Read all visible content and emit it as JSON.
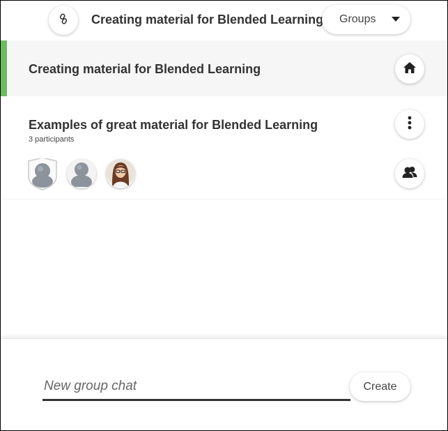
{
  "topbar": {
    "link_icon": "link-icon",
    "title": "Creating material for Blended Learning",
    "groups_label": "Groups",
    "dropdown_icon": "caret-down-icon"
  },
  "course": {
    "title": "Creating material for Blended Learning",
    "home_icon": "home-icon"
  },
  "group": {
    "title": "Examples of great material for Blended Learning",
    "participants": "3 participants",
    "menu_icon": "more-vertical-icon",
    "members_icon": "users-icon",
    "avatars": [
      "default-avatar-shield",
      "default-avatar",
      "user-photo-avatar"
    ]
  },
  "colors": {
    "accent": "#6dbb5e",
    "course_header_bg": "#f6f6f6"
  },
  "chat": {
    "placeholder": "New group chat",
    "value": "",
    "create_label": "Create"
  }
}
